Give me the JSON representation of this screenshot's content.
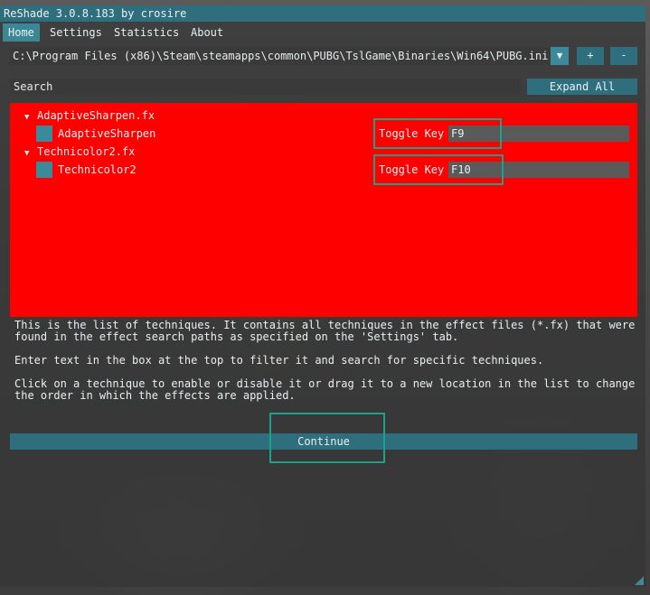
{
  "window": {
    "title": "ReShade 3.0.8.183 by crosire"
  },
  "menu": {
    "items": [
      "Home",
      "Settings",
      "Statistics",
      "About"
    ],
    "active": "Home"
  },
  "preset": {
    "path": "C:\\Program Files (x86)\\Steam\\steamapps\\common\\PUBG\\TslGame\\Binaries\\Win64\\PUBG.ini",
    "dropdown_icon": "triangle-down-icon",
    "add_label": "+",
    "remove_label": "-"
  },
  "search": {
    "placeholder": "Search",
    "expand_label": "Expand All"
  },
  "effects": [
    {
      "file": "AdaptiveSharpen.fx",
      "technique": "AdaptiveSharpen",
      "toggle_label": "Toggle Key",
      "key": "F9"
    },
    {
      "file": "Technicolor2.fx",
      "technique": "Technicolor2",
      "toggle_label": "Toggle Key",
      "key": "F10"
    }
  ],
  "description": [
    "This is the list of techniques. It contains all techniques in the effect files (*.fx) that were\nfound in the effect search paths as specified on the 'Settings' tab.",
    "Enter text in the box at the top to filter it and search for specific techniques.",
    "Click on a technique to enable or disable it or drag it to a new location in the list to change\nthe order in which the effects are applied."
  ],
  "continue_label": "Continue",
  "colors": {
    "accent": "#2f6f7d",
    "panel_bg": "#ff0000",
    "highlight": "#1aa389"
  }
}
